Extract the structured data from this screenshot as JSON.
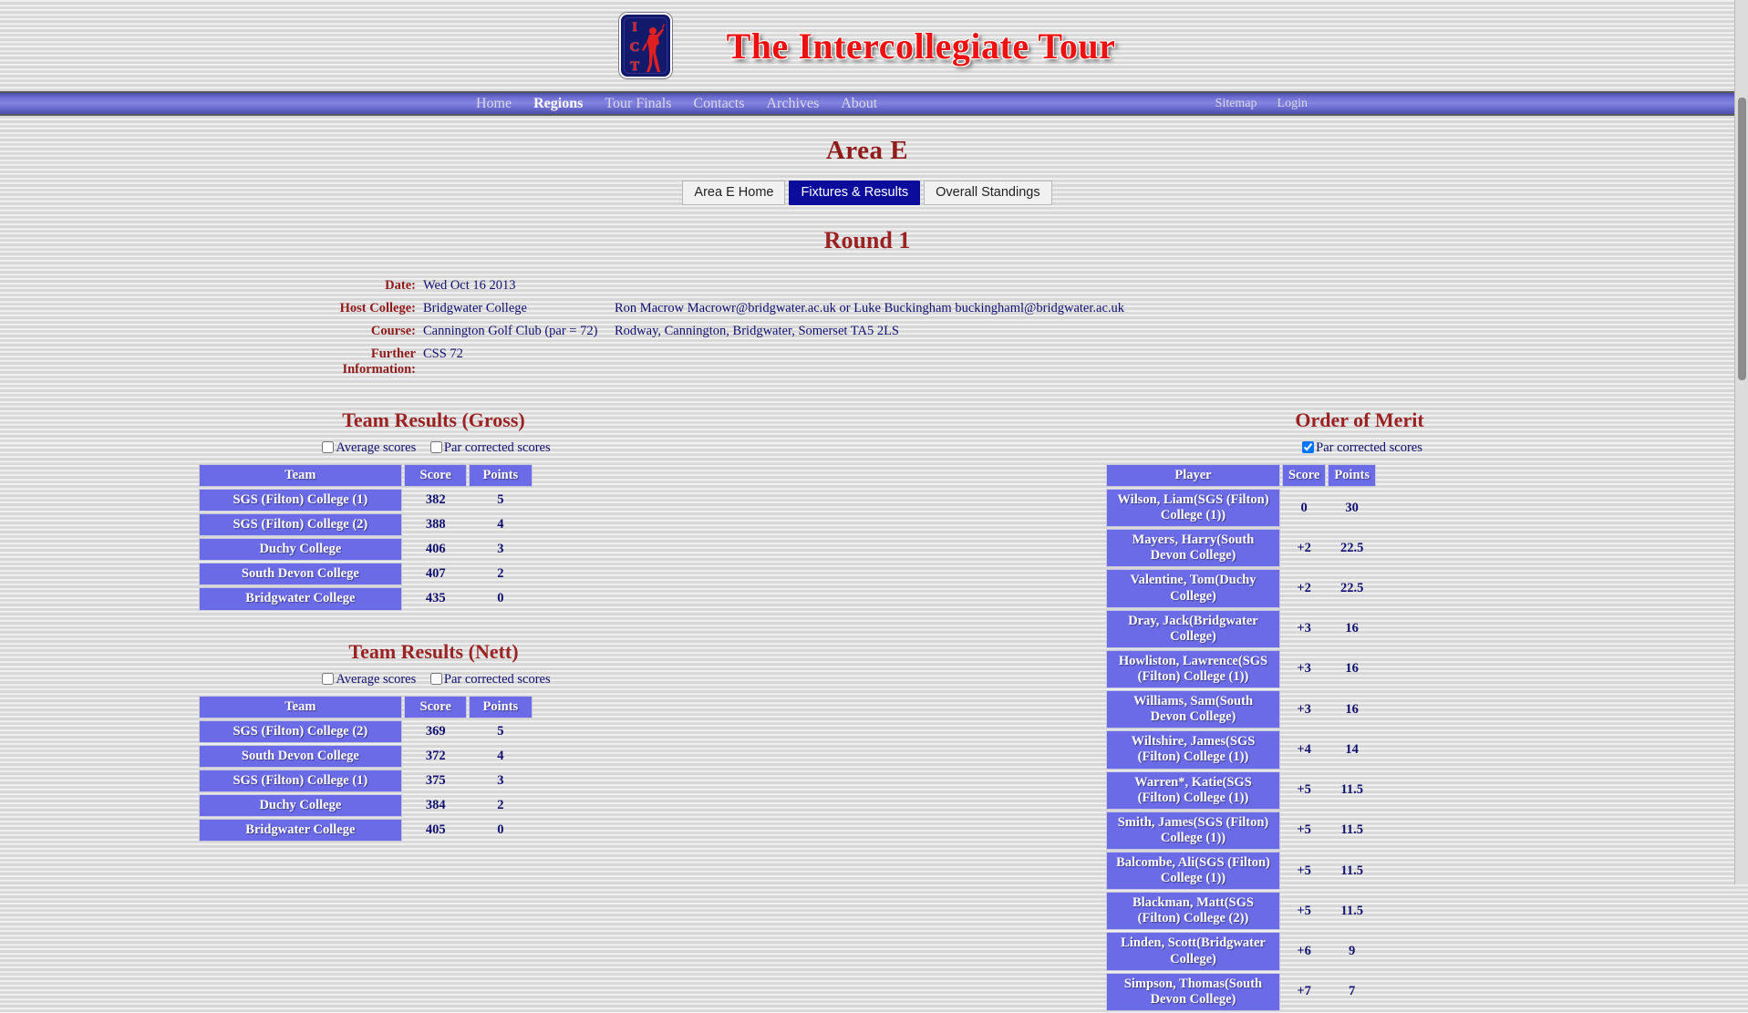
{
  "site": {
    "title": "The Intercollegiate Tour",
    "logo_letters": [
      "I",
      "C",
      "T"
    ],
    "brand_red": "#ee1111",
    "brand_navy": "#13196b"
  },
  "nav": {
    "main": [
      {
        "label": "Home",
        "active": false
      },
      {
        "label": "Regions",
        "active": true
      },
      {
        "label": "Tour Finals",
        "active": false
      },
      {
        "label": "Contacts",
        "active": false
      },
      {
        "label": "Archives",
        "active": false
      },
      {
        "label": "About",
        "active": false
      }
    ],
    "right": [
      {
        "label": "Sitemap"
      },
      {
        "label": "Login"
      }
    ]
  },
  "page": {
    "title": "Area E",
    "round_title": "Round 1"
  },
  "tabs": [
    {
      "label": "Area E Home",
      "active": false
    },
    {
      "label": "Fixtures & Results",
      "active": true
    },
    {
      "label": "Overall Standings",
      "active": false
    }
  ],
  "info": [
    {
      "label": "Date:",
      "value": "Wed Oct 16 2013",
      "extra": ""
    },
    {
      "label": "Host College:",
      "value": "Bridgwater College",
      "extra": "Ron Macrow Macrowr@bridgwater.ac.uk or Luke Buckingham buckinghaml@bridgwater.ac.uk"
    },
    {
      "label": "Course:",
      "value": "Cannington Golf Club (par = 72)",
      "extra": "Rodway, Cannington, Bridgwater, Somerset TA5 2LS"
    },
    {
      "label": "Further Information:",
      "value": "CSS 72",
      "extra": ""
    }
  ],
  "team_gross": {
    "title": "Team Results (Gross)",
    "options": [
      {
        "label": "Average scores",
        "checked": false
      },
      {
        "label": "Par corrected scores",
        "checked": false
      }
    ],
    "columns": [
      "Team",
      "Score",
      "Points"
    ],
    "rows": [
      {
        "team": "SGS (Filton) College (1)",
        "score": "382",
        "points": "5"
      },
      {
        "team": "SGS (Filton) College (2)",
        "score": "388",
        "points": "4"
      },
      {
        "team": "Duchy College",
        "score": "406",
        "points": "3"
      },
      {
        "team": "South Devon College",
        "score": "407",
        "points": "2"
      },
      {
        "team": "Bridgwater College",
        "score": "435",
        "points": "0"
      }
    ]
  },
  "team_nett": {
    "title": "Team Results (Nett)",
    "options": [
      {
        "label": "Average scores",
        "checked": false
      },
      {
        "label": "Par corrected scores",
        "checked": false
      }
    ],
    "columns": [
      "Team",
      "Score",
      "Points"
    ],
    "rows": [
      {
        "team": "SGS (Filton) College (2)",
        "score": "369",
        "points": "5"
      },
      {
        "team": "South Devon College",
        "score": "372",
        "points": "4"
      },
      {
        "team": "SGS (Filton) College (1)",
        "score": "375",
        "points": "3"
      },
      {
        "team": "Duchy College",
        "score": "384",
        "points": "2"
      },
      {
        "team": "Bridgwater College",
        "score": "405",
        "points": "0"
      }
    ]
  },
  "order_of_merit": {
    "title": "Order of Merit",
    "options": [
      {
        "label": "Par corrected scores",
        "checked": true
      }
    ],
    "columns": [
      "Player",
      "Score",
      "Points"
    ],
    "rows": [
      {
        "player": "Wilson, Liam(SGS (Filton) College (1))",
        "score": "0",
        "points": "30"
      },
      {
        "player": "Mayers, Harry(South Devon College)",
        "score": "+2",
        "points": "22.5"
      },
      {
        "player": "Valentine, Tom(Duchy College)",
        "score": "+2",
        "points": "22.5"
      },
      {
        "player": "Dray, Jack(Bridgwater College)",
        "score": "+3",
        "points": "16"
      },
      {
        "player": "Howliston, Lawrence(SGS (Filton) College (1))",
        "score": "+3",
        "points": "16"
      },
      {
        "player": "Williams, Sam(South Devon College)",
        "score": "+3",
        "points": "16"
      },
      {
        "player": "Wiltshire, James(SGS (Filton) College (1))",
        "score": "+4",
        "points": "14"
      },
      {
        "player": "Warren*, Katie(SGS (Filton) College (1))",
        "score": "+5",
        "points": "11.5"
      },
      {
        "player": "Smith, James(SGS (Filton) College (1))",
        "score": "+5",
        "points": "11.5"
      },
      {
        "player": "Balcombe, Ali(SGS (Filton) College (1))",
        "score": "+5",
        "points": "11.5"
      },
      {
        "player": "Blackman, Matt(SGS (Filton) College (2))",
        "score": "+5",
        "points": "11.5"
      },
      {
        "player": "Linden, Scott(Bridgwater College)",
        "score": "+6",
        "points": "9"
      },
      {
        "player": "Simpson, Thomas(South Devon College)",
        "score": "+7",
        "points": "7"
      }
    ]
  }
}
